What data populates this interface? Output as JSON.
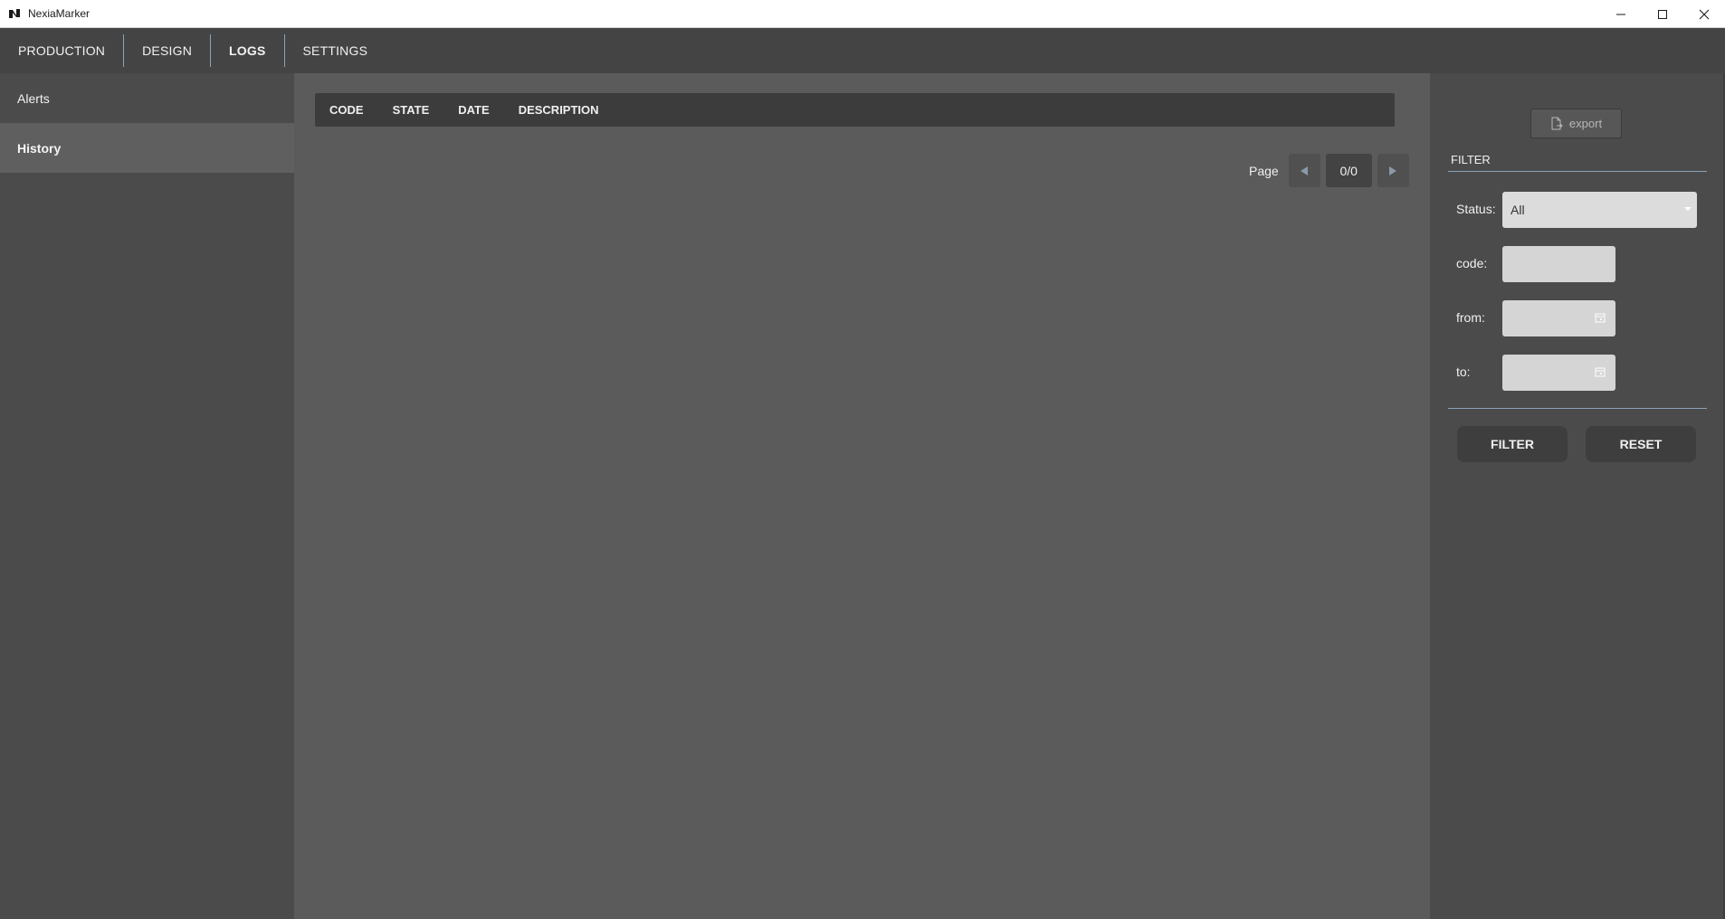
{
  "window": {
    "title": "NexiaMarker"
  },
  "nav": {
    "tabs": [
      {
        "label": "PRODUCTION"
      },
      {
        "label": "DESIGN"
      },
      {
        "label": "LOGS"
      },
      {
        "label": "SETTINGS"
      }
    ],
    "active": "LOGS"
  },
  "sidebar": {
    "items": [
      {
        "label": "Alerts"
      },
      {
        "label": "History"
      }
    ],
    "active": "History"
  },
  "table": {
    "columns": [
      "CODE",
      "STATE",
      "DATE",
      "DESCRIPTION"
    ],
    "rows": []
  },
  "pager": {
    "label": "Page",
    "value": "0/0"
  },
  "right_panel": {
    "export_label": "export",
    "filter_title": "FILTER",
    "status_label": "Status:",
    "status_value": "All",
    "code_label": "code:",
    "code_value": "",
    "from_label": "from:",
    "from_value": "",
    "to_label": "to:",
    "to_value": "",
    "filter_button": "FILTER",
    "reset_button": "RESET"
  },
  "icons": {
    "app": "app-logo-icon",
    "minimize": "minimize-icon",
    "maximize": "maximize-icon",
    "close": "close-icon",
    "prev": "triangle-left-icon",
    "next": "triangle-right-icon",
    "export": "file-export-icon",
    "calendar": "calendar-icon"
  },
  "colors": {
    "nav_bg": "#444444",
    "sidebar_bg": "#4b4b4b",
    "main_bg": "#5b5b5b",
    "accent_line": "#8aa3b8",
    "button_bg": "#3e3e3e"
  }
}
